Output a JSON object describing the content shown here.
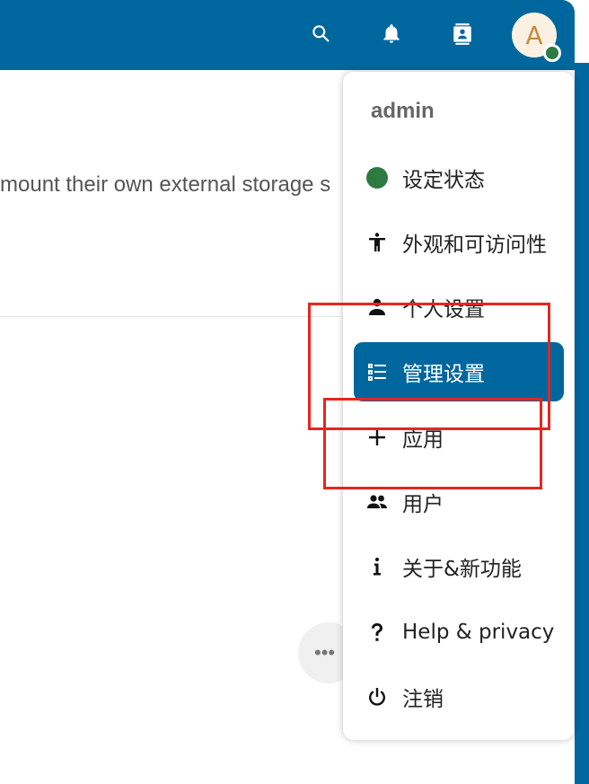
{
  "header": {
    "icons": [
      "search-icon",
      "bell-icon",
      "contacts-icon"
    ],
    "avatar_letter": "A",
    "avatar_status_color": "#2d7b41",
    "background": "#00679e"
  },
  "content": {
    "text": "mount their own external storage s"
  },
  "menu": {
    "username": "admin",
    "items": [
      {
        "label": "设定状态",
        "icon": "status-dot-icon"
      },
      {
        "label": "外观和可访问性",
        "icon": "accessibility-icon"
      },
      {
        "label": "个人设置",
        "icon": "user-icon"
      },
      {
        "label": "管理设置",
        "icon": "admin-settings-icon",
        "active": true
      },
      {
        "label": "应用",
        "icon": "plus-icon"
      },
      {
        "label": "用户",
        "icon": "users-icon"
      },
      {
        "label": "关于&新功能",
        "icon": "info-icon"
      },
      {
        "label": "Help & privacy",
        "icon": "help-icon"
      },
      {
        "label": "注销",
        "icon": "power-icon"
      }
    ]
  },
  "more_button": {
    "label": "•••"
  },
  "colors": {
    "accent": "#00679e",
    "status_online": "#2d7b41",
    "annotation": "#e5261e"
  }
}
